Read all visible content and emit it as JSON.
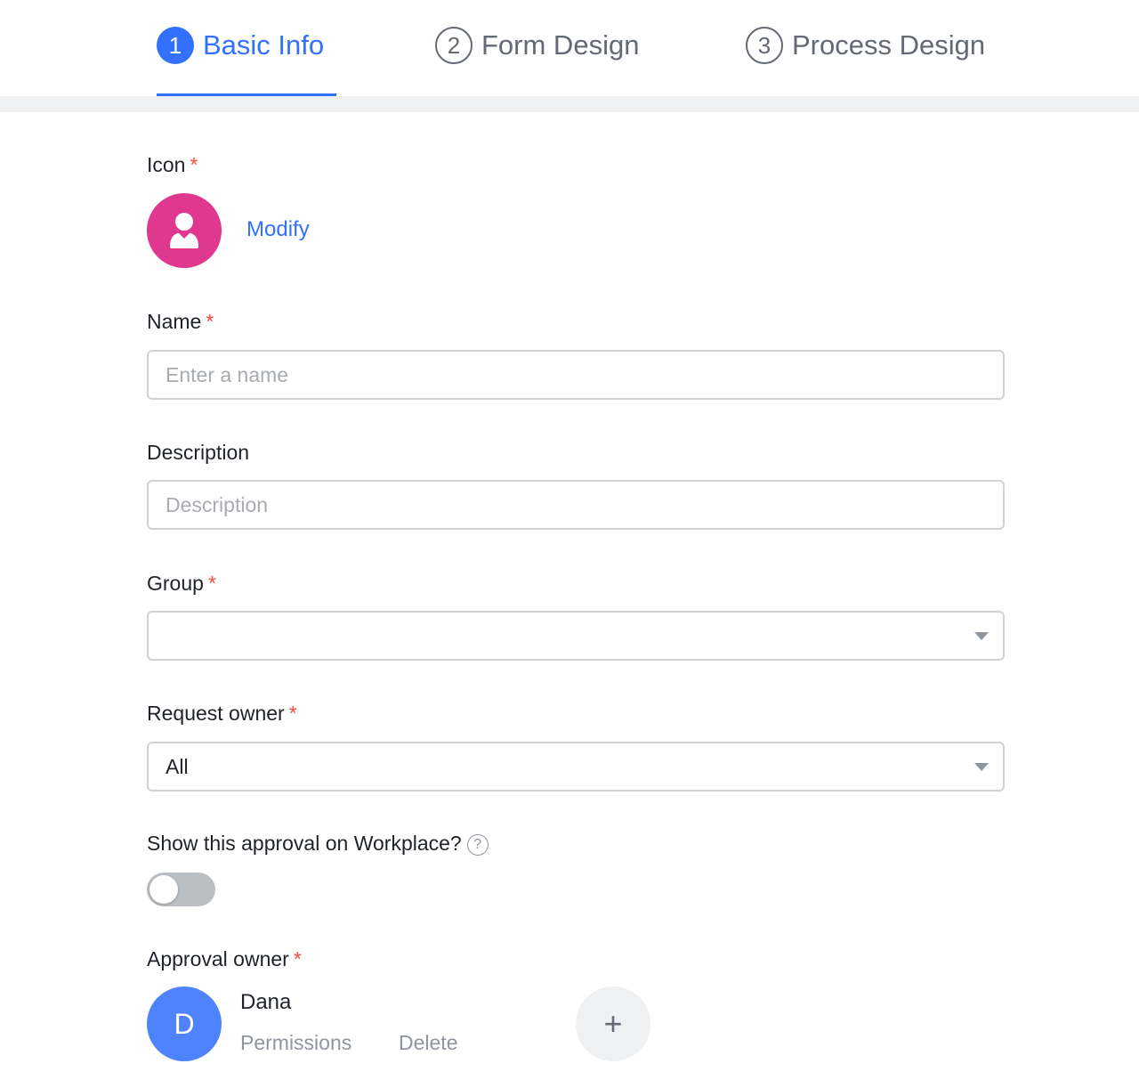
{
  "steps": [
    {
      "number": "1",
      "label": "Basic Info",
      "state": "active"
    },
    {
      "number": "2",
      "label": "Form Design",
      "state": "inactive"
    },
    {
      "number": "3",
      "label": "Process Design",
      "state": "inactive"
    }
  ],
  "form": {
    "icon": {
      "label": "Icon",
      "required_mark": "*",
      "modify_label": "Modify",
      "icon_color": "#e0378f",
      "icon_name": "user-icon"
    },
    "name": {
      "label": "Name",
      "required_mark": "*",
      "placeholder": "Enter a name",
      "value": ""
    },
    "description": {
      "label": "Description",
      "placeholder": "Description",
      "value": ""
    },
    "group": {
      "label": "Group",
      "required_mark": "*",
      "value": ""
    },
    "request_owner": {
      "label": "Request owner",
      "required_mark": "*",
      "value": "All"
    },
    "show_on_workplace": {
      "label": "Show this approval on Workplace?",
      "help": "?",
      "enabled": false
    },
    "approval_owner": {
      "label": "Approval owner",
      "required_mark": "*",
      "owners": [
        {
          "initial": "D",
          "name": "Dana",
          "permissions_label": "Permissions",
          "delete_label": "Delete"
        }
      ],
      "add_label": "+"
    }
  },
  "colors": {
    "accent": "#3370ff",
    "required": "#f54a45",
    "avatar": "#4e83fd"
  }
}
